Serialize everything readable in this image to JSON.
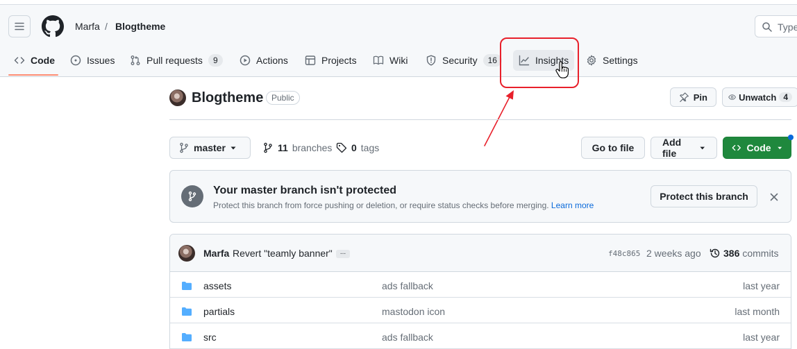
{
  "header": {
    "owner": "Marfa",
    "separator": "/",
    "repo": "Blogtheme",
    "search_placeholder": "Type"
  },
  "tabs": [
    {
      "label": "Code",
      "icon": "code-icon",
      "active": true
    },
    {
      "label": "Issues",
      "icon": "issue-icon"
    },
    {
      "label": "Pull requests",
      "icon": "pull-request-icon",
      "count": "9"
    },
    {
      "label": "Actions",
      "icon": "play-icon"
    },
    {
      "label": "Projects",
      "icon": "table-icon"
    },
    {
      "label": "Wiki",
      "icon": "book-icon"
    },
    {
      "label": "Security",
      "icon": "shield-icon",
      "count": "16"
    },
    {
      "label": "Insights",
      "icon": "graph-icon",
      "hovered": true
    },
    {
      "label": "Settings",
      "icon": "gear-icon"
    }
  ],
  "repo": {
    "name": "Blogtheme",
    "visibility": "Public",
    "pin_label": "Pin",
    "unwatch_label": "Unwatch",
    "watch_count": "4"
  },
  "branch_bar": {
    "current_branch": "master",
    "branches_count": "11",
    "branches_label": "branches",
    "tags_count": "0",
    "tags_label": "tags",
    "goto_file": "Go to file",
    "add_file": "Add file",
    "code_button": "Code"
  },
  "banner": {
    "title": "Your master branch isn't protected",
    "description": "Protect this branch from force pushing or deletion, or require status checks before merging.",
    "link": "Learn more",
    "button": "Protect this branch"
  },
  "latest_commit": {
    "author": "Marfa",
    "message": "Revert \"teamly banner\"",
    "ellipsis": "...",
    "sha": "f48c865",
    "time": "2 weeks ago",
    "commits_count": "386",
    "commits_label": "commits"
  },
  "files": [
    {
      "name": "assets",
      "message": "ads fallback",
      "time": "last year"
    },
    {
      "name": "partials",
      "message": "mastodon icon",
      "time": "last month"
    },
    {
      "name": "src",
      "message": "ads fallback",
      "time": "last year"
    }
  ],
  "colors": {
    "accent_underline": "#fd8c73",
    "code_button": "#1f883d",
    "highlight_box": "#e8202b",
    "link": "#0969da",
    "folder": "#54aeff"
  }
}
